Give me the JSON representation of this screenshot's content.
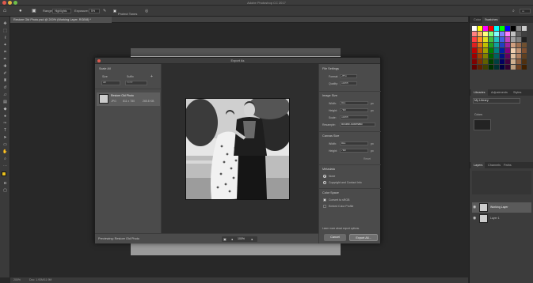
{
  "app": {
    "title": "Adobe Photoshop CC 2017",
    "document_tab": "Restore Old Photo.psd @ 200% (Working Layer, RGB/8) *"
  },
  "options_bar": {
    "range_label": "Range:",
    "range_value": "Highlights",
    "exposure_label": "Exposure:",
    "exposure_value": "5%",
    "protect_tones": "Protect Tones"
  },
  "status_bar": {
    "zoom": "200%",
    "doc_size": "Doc: 1.93M/11.9M"
  },
  "dialog": {
    "title": "Export As",
    "left": {
      "header": "Scale All",
      "size_label": "Size",
      "suffix_label": "Suffix",
      "size_value": "1x",
      "suffix_placeholder": "none",
      "asset_name": "Restore Old Photo",
      "asset_format": "JPG",
      "asset_dims": "811 x 780",
      "asset_size": "265.8 KB"
    },
    "file_settings": {
      "header": "File Settings",
      "format_label": "Format:",
      "format_value": "JPG",
      "quality_label": "Quality:",
      "quality_value": "100%"
    },
    "image_size": {
      "header": "Image Size",
      "width_label": "Width:",
      "width_value": "811",
      "height_label": "Height:",
      "height_value": "780",
      "scale_label": "Scale:",
      "scale_value": "100%",
      "resample_label": "Resample:",
      "resample_value": "Bicubic Automatic",
      "unit": "px"
    },
    "canvas_size": {
      "header": "Canvas Size",
      "width_label": "Width:",
      "width_value": "811",
      "height_label": "Height:",
      "height_value": "780",
      "reset": "Reset",
      "unit": "px"
    },
    "metadata": {
      "header": "Metadata",
      "none": "None",
      "copyright": "Copyright and Contact Info"
    },
    "color_space": {
      "header": "Color Space",
      "convert": "Convert to sRGB",
      "embed": "Embed Color Profile"
    },
    "learn_more": "Learn more about export options.",
    "previewing": "Previewing: Restore Old Photo",
    "zoom_value": "100%",
    "cancel": "Cancel",
    "export_all": "Export All..."
  },
  "right_panel": {
    "color_tabs": [
      "Color",
      "Swatches"
    ],
    "lib_tabs": [
      "Libraries",
      "Adjustments",
      "Styles"
    ],
    "library_name": "My Library",
    "colors_label": "Colors",
    "layer_tabs": [
      "Layers",
      "Channels",
      "Paths"
    ],
    "layers": [
      "Working Layer",
      "Layer 1"
    ]
  },
  "colors": {
    "accent": "#e05a4e",
    "swatches": [
      "#ffffff",
      "#ffff00",
      "#ff00ff",
      "#ff0000",
      "#00ffff",
      "#00ff00",
      "#0000ff",
      "#000000",
      "#888888",
      "#cccccc",
      "#ff8080",
      "#ffb060",
      "#ffff80",
      "#80ff80",
      "#80ffff",
      "#8080ff",
      "#ff80ff",
      "#c0c0c0",
      "#606060",
      "#404040",
      "#ff4040",
      "#ff9020",
      "#e0e020",
      "#40c040",
      "#20c0c0",
      "#4060e0",
      "#c040c0",
      "#a0a0a0",
      "#808080",
      "#202020",
      "#e02020",
      "#e07010",
      "#c0c000",
      "#20a020",
      "#10a0a0",
      "#2040c0",
      "#a020a0",
      "#d0a080",
      "#a07050",
      "#705030",
      "#c00000",
      "#c05000",
      "#a0a000",
      "#008000",
      "#008080",
      "#0020a0",
      "#800080",
      "#f0d0b0",
      "#c09070",
      "#805030",
      "#a00000",
      "#a04000",
      "#808000",
      "#006000",
      "#006060",
      "#001080",
      "#600060",
      "#e0c0a0",
      "#b08060",
      "#604020",
      "#800000",
      "#803000",
      "#606000",
      "#004000",
      "#004040",
      "#000060",
      "#400040",
      "#d0b090",
      "#906040",
      "#503010",
      "#600000",
      "#602000",
      "#404000",
      "#003000",
      "#003030",
      "#000040",
      "#300030",
      "#c0a080",
      "#704020",
      "#402000"
    ]
  }
}
